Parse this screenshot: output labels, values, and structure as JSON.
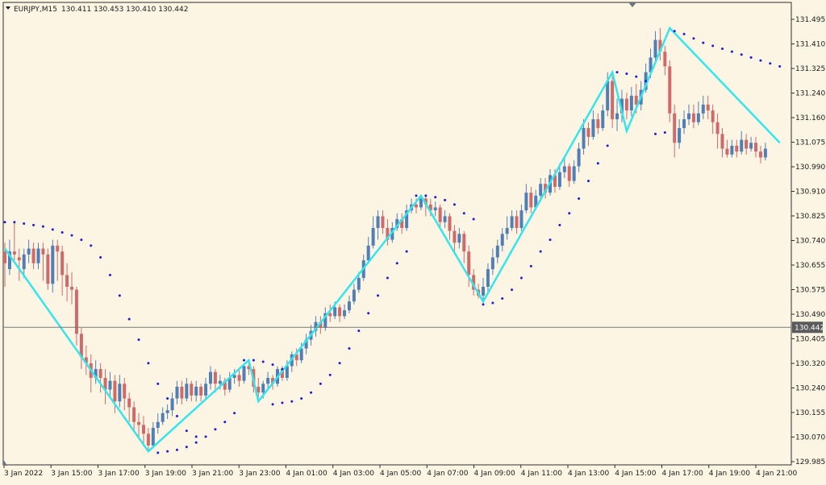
{
  "header": {
    "symbol": "EURJPY,M15",
    "ohlc": "130.411 130.453 130.410 130.442"
  },
  "current_price": "130.442",
  "colors": {
    "background": "#fdf5e4",
    "bull": "#4f7fb5",
    "bear": "#cf6a6a",
    "zigzag": "#33e6ee",
    "sar": "#1c1cd4",
    "axis_text": "#1b1b1b"
  },
  "chart_data": {
    "type": "candlestick",
    "indicators": [
      "ZigZag",
      "Parabolic SAR"
    ],
    "ylim": [
      129.985,
      131.49
    ],
    "y_ticks": [
      "131.495",
      "131.410",
      "131.325",
      "131.240",
      "131.160",
      "131.075",
      "130.990",
      "130.910",
      "130.825",
      "130.740",
      "130.655",
      "130.575",
      "130.490",
      "130.405",
      "130.320",
      "130.240",
      "130.155",
      "130.070",
      "129.985"
    ],
    "x_ticks": [
      "3 Jan 2022",
      "3 Jan 15:00",
      "3 Jan 17:00",
      "3 Jan 19:00",
      "3 Jan 21:00",
      "3 Jan 23:00",
      "4 Jan 01:00",
      "4 Jan 03:00",
      "4 Jan 05:00",
      "4 Jan 07:00",
      "4 Jan 09:00",
      "4 Jan 11:00",
      "4 Jan 13:00",
      "4 Jan 15:00",
      "4 Jan 17:00",
      "4 Jan 19:00",
      "4 Jan 21:00"
    ],
    "zigzag": [
      {
        "bar": 0,
        "price": 130.71
      },
      {
        "bar": 30,
        "price": 130.02
      },
      {
        "bar": 51,
        "price": 130.33
      },
      {
        "bar": 53,
        "price": 130.19
      },
      {
        "bar": 87,
        "price": 130.89
      },
      {
        "bar": 100,
        "price": 130.53
      },
      {
        "bar": 127,
        "price": 131.31
      },
      {
        "bar": 130,
        "price": 131.11
      },
      {
        "bar": 139,
        "price": 131.46
      },
      {
        "bar": 162,
        "price": 131.07
      }
    ],
    "sar": [
      [
        0,
        130.8
      ],
      [
        2,
        130.8
      ],
      [
        4,
        130.795
      ],
      [
        6,
        130.79
      ],
      [
        8,
        130.785
      ],
      [
        10,
        130.775
      ],
      [
        12,
        130.765
      ],
      [
        14,
        130.755
      ],
      [
        16,
        130.74
      ],
      [
        18,
        130.72
      ],
      [
        20,
        130.68
      ],
      [
        22,
        130.62
      ],
      [
        24,
        130.55
      ],
      [
        26,
        130.47
      ],
      [
        28,
        130.4
      ],
      [
        30,
        130.32
      ],
      [
        32,
        130.25
      ],
      [
        34,
        130.2
      ],
      [
        36,
        130.14
      ],
      [
        38,
        130.09
      ],
      [
        40,
        130.07
      ],
      [
        32,
        130.015
      ],
      [
        34,
        130.02
      ],
      [
        36,
        130.025
      ],
      [
        38,
        130.035
      ],
      [
        40,
        130.05
      ],
      [
        42,
        130.07
      ],
      [
        44,
        130.095
      ],
      [
        46,
        130.12
      ],
      [
        48,
        130.15
      ],
      [
        50,
        130.33
      ],
      [
        52,
        130.33
      ],
      [
        54,
        130.325
      ],
      [
        56,
        130.315
      ],
      [
        58,
        130.3
      ],
      [
        56,
        130.18
      ],
      [
        58,
        130.185
      ],
      [
        60,
        130.19
      ],
      [
        62,
        130.2
      ],
      [
        64,
        130.22
      ],
      [
        66,
        130.25
      ],
      [
        68,
        130.28
      ],
      [
        70,
        130.32
      ],
      [
        72,
        130.37
      ],
      [
        74,
        130.43
      ],
      [
        76,
        130.49
      ],
      [
        78,
        130.55
      ],
      [
        80,
        130.61
      ],
      [
        82,
        130.66
      ],
      [
        84,
        130.7
      ],
      [
        86,
        130.89
      ],
      [
        88,
        130.89
      ],
      [
        90,
        130.885
      ],
      [
        92,
        130.875
      ],
      [
        94,
        130.86
      ],
      [
        96,
        130.83
      ],
      [
        98,
        130.81
      ],
      [
        100,
        130.52
      ],
      [
        102,
        130.525
      ],
      [
        104,
        130.54
      ],
      [
        106,
        130.57
      ],
      [
        108,
        130.61
      ],
      [
        110,
        130.65
      ],
      [
        112,
        130.7
      ],
      [
        114,
        130.74
      ],
      [
        116,
        130.79
      ],
      [
        118,
        130.83
      ],
      [
        120,
        130.88
      ],
      [
        122,
        130.94
      ],
      [
        124,
        131.0
      ],
      [
        126,
        131.06
      ],
      [
        128,
        131.31
      ],
      [
        130,
        131.305
      ],
      [
        132,
        131.295
      ],
      [
        134,
        131.28
      ],
      [
        136,
        131.1
      ],
      [
        138,
        131.105
      ],
      [
        140,
        131.45
      ],
      [
        142,
        131.44
      ],
      [
        144,
        131.425
      ],
      [
        146,
        131.41
      ],
      [
        148,
        131.4
      ],
      [
        150,
        131.39
      ],
      [
        152,
        131.38
      ],
      [
        154,
        131.37
      ],
      [
        156,
        131.36
      ],
      [
        158,
        131.35
      ],
      [
        160,
        131.34
      ],
      [
        162,
        131.33
      ]
    ],
    "candles": [
      [
        130.7,
        130.66,
        130.73,
        130.58
      ],
      [
        130.64,
        130.7,
        130.74,
        130.62
      ],
      [
        130.7,
        130.69,
        130.8,
        130.67
      ],
      [
        130.68,
        130.67,
        130.71,
        130.6
      ],
      [
        130.64,
        130.69,
        130.71,
        130.61
      ],
      [
        130.69,
        130.71,
        130.74,
        130.66
      ],
      [
        130.71,
        130.66,
        130.73,
        130.64
      ],
      [
        130.66,
        130.71,
        130.73,
        130.64
      ],
      [
        130.71,
        130.69,
        130.73,
        130.6
      ],
      [
        130.69,
        130.59,
        130.71,
        130.57
      ],
      [
        130.59,
        130.72,
        130.74,
        130.56
      ],
      [
        130.72,
        130.7,
        130.74,
        130.6
      ],
      [
        130.7,
        130.62,
        130.72,
        130.55
      ],
      [
        130.62,
        130.58,
        130.66,
        130.53
      ],
      [
        130.58,
        130.57,
        130.63,
        130.52
      ],
      [
        130.57,
        130.42,
        130.58,
        130.38
      ],
      [
        130.42,
        130.34,
        130.44,
        130.3
      ],
      [
        130.34,
        130.32,
        130.38,
        130.28
      ],
      [
        130.32,
        130.27,
        130.35,
        130.22
      ],
      [
        130.27,
        130.3,
        130.33,
        130.25
      ],
      [
        130.3,
        130.27,
        130.32,
        130.22
      ],
      [
        130.27,
        130.23,
        130.3,
        130.18
      ],
      [
        130.23,
        130.26,
        130.29,
        130.2
      ],
      [
        130.26,
        130.19,
        130.28,
        130.15
      ],
      [
        130.19,
        130.25,
        130.28,
        130.17
      ],
      [
        130.25,
        130.2,
        130.27,
        130.16
      ],
      [
        130.2,
        130.17,
        130.22,
        130.12
      ],
      [
        130.17,
        130.12,
        130.19,
        130.09
      ],
      [
        130.12,
        130.11,
        130.15,
        130.06
      ],
      [
        130.11,
        130.08,
        130.14,
        130.04
      ],
      [
        130.08,
        130.04,
        130.1,
        130.02
      ],
      [
        130.04,
        130.1,
        130.12,
        130.03
      ],
      [
        130.1,
        130.12,
        130.15,
        130.08
      ],
      [
        130.12,
        130.15,
        130.17,
        130.11
      ],
      [
        130.15,
        130.16,
        130.18,
        130.13
      ],
      [
        130.16,
        130.2,
        130.22,
        130.14
      ],
      [
        130.2,
        130.24,
        130.26,
        130.18
      ],
      [
        130.24,
        130.2,
        130.26,
        130.18
      ],
      [
        130.2,
        130.25,
        130.27,
        130.19
      ],
      [
        130.25,
        130.21,
        130.26,
        130.19
      ],
      [
        130.21,
        130.24,
        130.26,
        130.19
      ],
      [
        130.24,
        130.21,
        130.25,
        130.19
      ],
      [
        130.21,
        130.25,
        130.27,
        130.2
      ],
      [
        130.25,
        130.29,
        130.31,
        130.23
      ],
      [
        130.29,
        130.25,
        130.3,
        130.22
      ],
      [
        130.25,
        130.26,
        130.28,
        130.23
      ],
      [
        130.26,
        130.23,
        130.27,
        130.21
      ],
      [
        130.23,
        130.27,
        130.29,
        130.22
      ],
      [
        130.27,
        130.28,
        130.3,
        130.25
      ],
      [
        130.28,
        130.26,
        130.3,
        130.24
      ],
      [
        130.26,
        130.31,
        130.32,
        130.25
      ],
      [
        130.31,
        130.3,
        130.33,
        130.28
      ],
      [
        130.3,
        130.24,
        130.31,
        130.22
      ],
      [
        130.24,
        130.22,
        130.27,
        130.19
      ],
      [
        130.22,
        130.25,
        130.26,
        130.2
      ],
      [
        130.25,
        130.27,
        130.29,
        130.23
      ],
      [
        130.27,
        130.25,
        130.28,
        130.23
      ],
      [
        130.25,
        130.3,
        130.31,
        130.24
      ],
      [
        130.3,
        130.27,
        130.31,
        130.26
      ],
      [
        130.27,
        130.31,
        130.33,
        130.26
      ],
      [
        130.31,
        130.35,
        130.36,
        130.29
      ],
      [
        130.35,
        130.33,
        130.37,
        130.31
      ],
      [
        130.33,
        130.37,
        130.39,
        130.32
      ],
      [
        130.37,
        130.4,
        130.42,
        130.35
      ],
      [
        130.4,
        130.43,
        130.45,
        130.38
      ],
      [
        130.43,
        130.46,
        130.48,
        130.41
      ],
      [
        130.46,
        130.44,
        130.48,
        130.42
      ],
      [
        130.44,
        130.49,
        130.51,
        130.43
      ],
      [
        130.49,
        130.48,
        130.52,
        130.46
      ],
      [
        130.48,
        130.51,
        130.53,
        130.47
      ],
      [
        130.51,
        130.48,
        130.52,
        130.46
      ],
      [
        130.48,
        130.5,
        130.52,
        130.47
      ],
      [
        130.5,
        130.53,
        130.55,
        130.49
      ],
      [
        130.53,
        130.57,
        130.59,
        130.52
      ],
      [
        130.57,
        130.61,
        130.63,
        130.56
      ],
      [
        130.61,
        130.67,
        130.69,
        130.6
      ],
      [
        130.67,
        130.72,
        130.75,
        130.66
      ],
      [
        130.72,
        130.78,
        130.82,
        130.71
      ],
      [
        130.78,
        130.82,
        130.84,
        130.74
      ],
      [
        130.82,
        130.78,
        130.84,
        130.76
      ],
      [
        130.78,
        130.74,
        130.81,
        130.72
      ],
      [
        130.74,
        130.78,
        130.8,
        130.73
      ],
      [
        130.78,
        130.81,
        130.83,
        130.77
      ],
      [
        130.81,
        130.78,
        130.83,
        130.76
      ],
      [
        130.78,
        130.84,
        130.86,
        130.77
      ],
      [
        130.84,
        130.86,
        130.88,
        130.83
      ],
      [
        130.86,
        130.85,
        130.88,
        130.83
      ],
      [
        130.85,
        130.88,
        130.89,
        130.84
      ],
      [
        130.88,
        130.86,
        130.89,
        130.82
      ],
      [
        130.86,
        130.84,
        130.88,
        130.82
      ],
      [
        130.84,
        130.85,
        130.87,
        130.82
      ],
      [
        130.85,
        130.8,
        130.86,
        130.78
      ],
      [
        130.8,
        130.82,
        130.84,
        130.78
      ],
      [
        130.82,
        130.77,
        130.83,
        130.74
      ],
      [
        130.77,
        130.73,
        130.79,
        130.7
      ],
      [
        130.73,
        130.76,
        130.78,
        130.71
      ],
      [
        130.76,
        130.7,
        130.77,
        130.66
      ],
      [
        130.7,
        130.62,
        130.72,
        130.58
      ],
      [
        130.62,
        130.57,
        130.64,
        130.55
      ],
      [
        130.57,
        130.55,
        130.59,
        130.54
      ],
      [
        130.55,
        130.58,
        130.61,
        130.53
      ],
      [
        130.58,
        130.64,
        130.66,
        130.56
      ],
      [
        130.64,
        130.68,
        130.71,
        130.62
      ],
      [
        130.68,
        130.72,
        130.74,
        130.66
      ],
      [
        130.72,
        130.76,
        130.78,
        130.7
      ],
      [
        130.76,
        130.78,
        130.82,
        130.74
      ],
      [
        130.78,
        130.82,
        130.84,
        130.77
      ],
      [
        130.82,
        130.78,
        130.84,
        130.76
      ],
      [
        130.78,
        130.84,
        130.86,
        130.77
      ],
      [
        130.84,
        130.9,
        130.93,
        130.83
      ],
      [
        130.9,
        130.85,
        130.92,
        130.83
      ],
      [
        130.85,
        130.89,
        130.91,
        130.84
      ],
      [
        130.89,
        130.93,
        130.95,
        130.87
      ],
      [
        130.93,
        130.9,
        130.95,
        130.88
      ],
      [
        130.9,
        130.96,
        130.98,
        130.89
      ],
      [
        130.96,
        130.92,
        130.98,
        130.9
      ],
      [
        130.92,
        130.97,
        131.0,
        130.91
      ],
      [
        130.97,
        130.99,
        131.02,
        130.95
      ],
      [
        130.99,
        130.94,
        131.0,
        130.92
      ],
      [
        130.94,
        130.99,
        131.01,
        130.93
      ],
      [
        130.99,
        131.05,
        131.07,
        130.97
      ],
      [
        131.05,
        131.12,
        131.15,
        131.03
      ],
      [
        131.12,
        131.09,
        131.14,
        131.06
      ],
      [
        131.09,
        131.15,
        131.18,
        131.08
      ],
      [
        131.15,
        131.12,
        131.17,
        131.1
      ],
      [
        131.12,
        131.18,
        131.2,
        131.11
      ],
      [
        131.18,
        131.28,
        131.31,
        131.16
      ],
      [
        131.28,
        131.15,
        131.3,
        131.12
      ],
      [
        131.15,
        131.17,
        131.22,
        131.11
      ],
      [
        131.17,
        131.22,
        131.25,
        131.14
      ],
      [
        131.22,
        131.18,
        131.24,
        131.15
      ],
      [
        131.18,
        131.23,
        131.26,
        131.16
      ],
      [
        131.23,
        131.2,
        131.27,
        131.17
      ],
      [
        131.2,
        131.25,
        131.28,
        131.18
      ],
      [
        131.25,
        131.31,
        131.34,
        131.24
      ],
      [
        131.31,
        131.36,
        131.39,
        131.29
      ],
      [
        131.36,
        131.42,
        131.45,
        131.35
      ],
      [
        131.42,
        131.38,
        131.46,
        131.35
      ],
      [
        131.38,
        131.33,
        131.4,
        131.3
      ],
      [
        131.33,
        131.17,
        131.35,
        131.14
      ],
      [
        131.17,
        131.07,
        131.2,
        131.02
      ],
      [
        131.07,
        131.12,
        131.15,
        131.05
      ],
      [
        131.12,
        131.15,
        131.18,
        131.1
      ],
      [
        131.15,
        131.17,
        131.2,
        131.13
      ],
      [
        131.17,
        131.14,
        131.2,
        131.12
      ],
      [
        131.14,
        131.17,
        131.21,
        131.13
      ],
      [
        131.17,
        131.2,
        131.23,
        131.15
      ],
      [
        131.2,
        131.18,
        131.23,
        131.15
      ],
      [
        131.18,
        131.14,
        131.2,
        131.1
      ],
      [
        131.14,
        131.1,
        131.17,
        131.05
      ],
      [
        131.1,
        131.05,
        131.12,
        131.02
      ],
      [
        131.05,
        131.03,
        131.08,
        131.02
      ],
      [
        131.03,
        131.06,
        131.08,
        131.02
      ],
      [
        131.06,
        131.04,
        131.08,
        131.02
      ],
      [
        131.04,
        131.08,
        131.11,
        131.03
      ],
      [
        131.08,
        131.05,
        131.1,
        131.03
      ],
      [
        131.05,
        131.07,
        131.09,
        131.04
      ],
      [
        131.07,
        131.04,
        131.09,
        131.02
      ],
      [
        131.04,
        131.02,
        131.06,
        131.0
      ],
      [
        131.02,
        131.05,
        131.07,
        131.01
      ]
    ]
  }
}
